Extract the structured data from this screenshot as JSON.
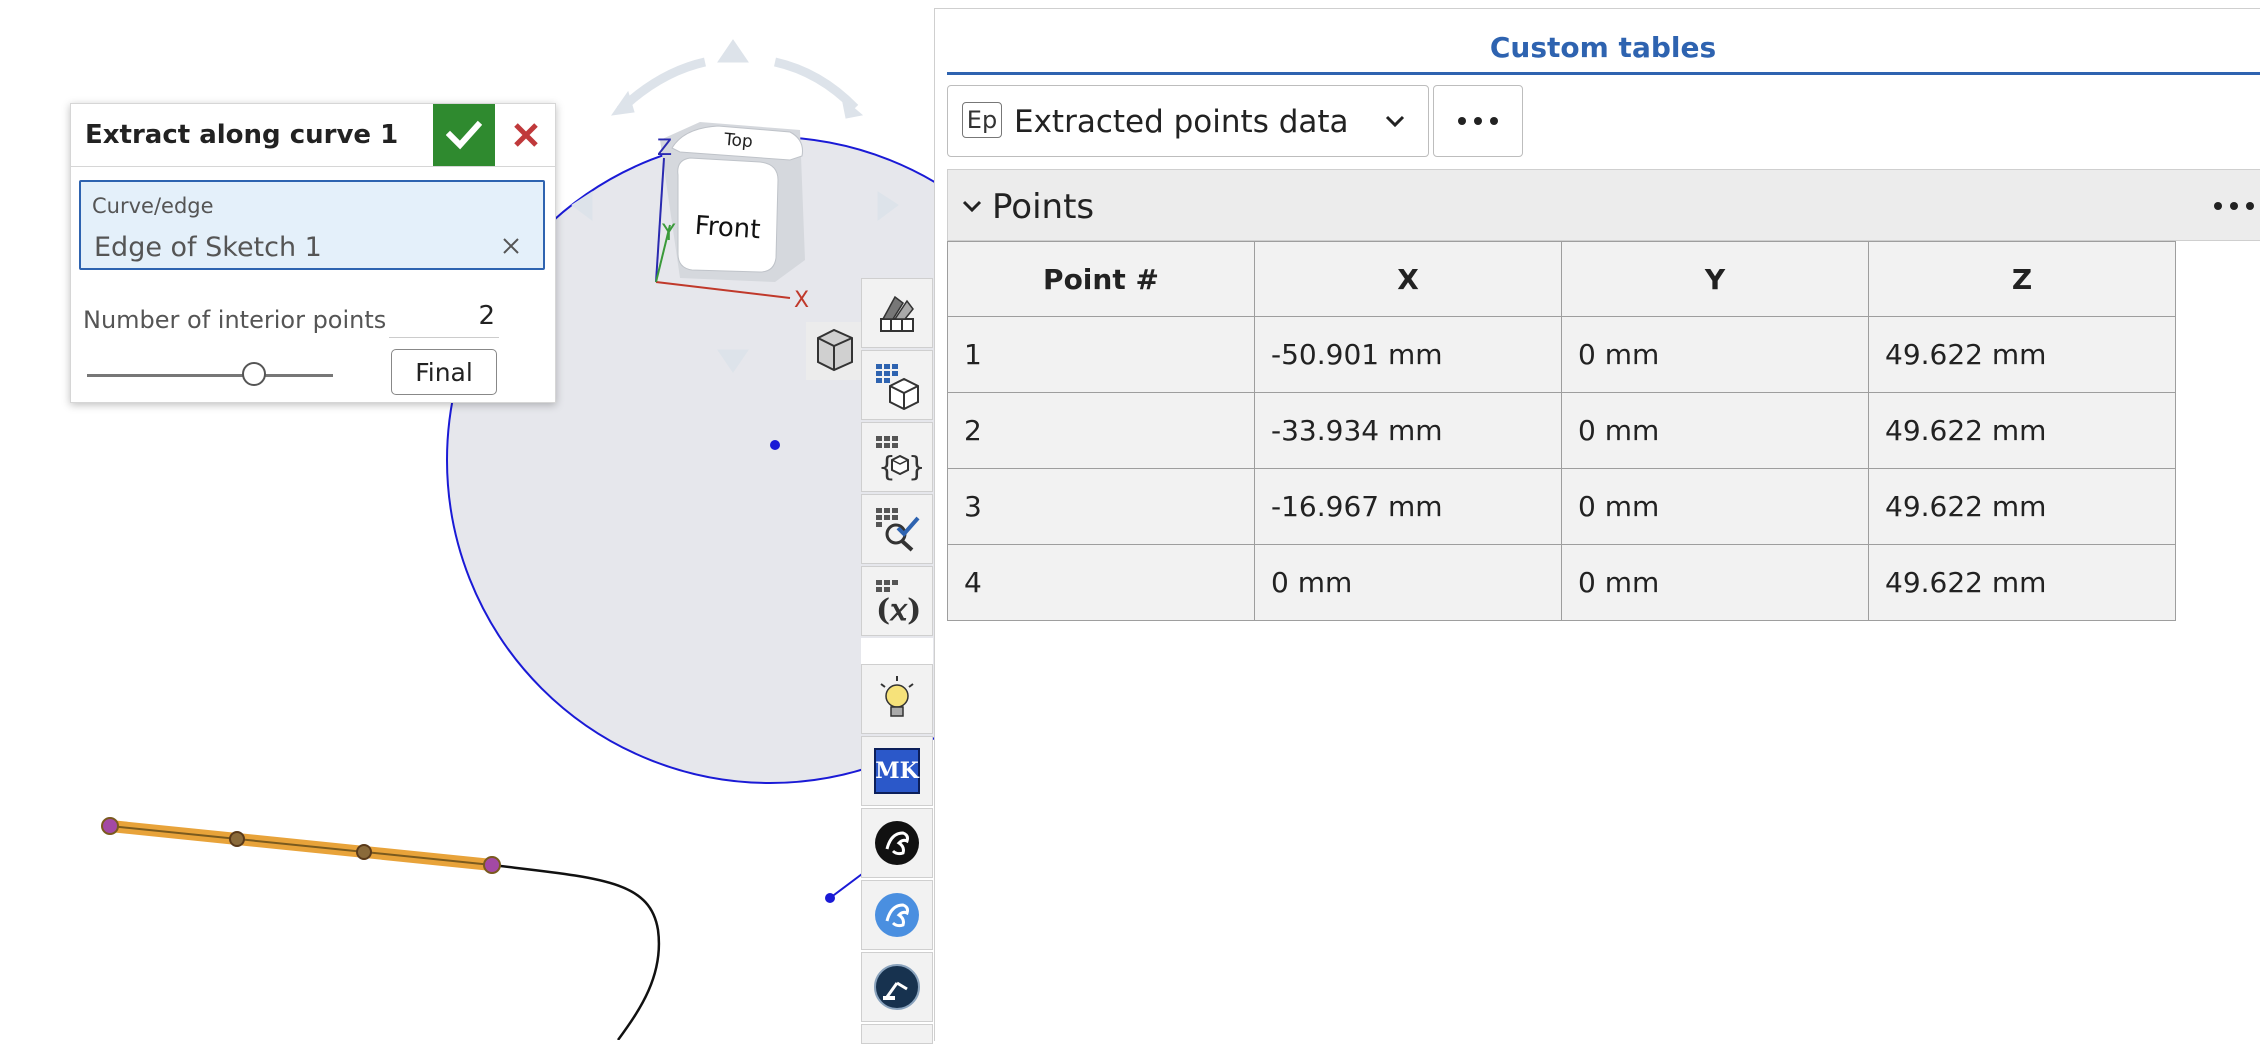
{
  "dialog": {
    "title": "Extract along curve 1",
    "curve_field_label": "Curve/edge",
    "curve_field_value": "Edge of Sketch 1",
    "interior_points_label": "Number of interior points",
    "interior_points_value": "2",
    "slider_value_fraction": 0.68,
    "final_button_label": "Final",
    "accept_color": "#2f8a2f",
    "cancel_color": "#c0393b"
  },
  "view_cube": {
    "face_front": "Front",
    "face_top": "Top",
    "axis_x": "X",
    "axis_y": "Y",
    "axis_z": "Z"
  },
  "toolbar": {
    "tools": [
      "appearance-tool-icon",
      "parts-table-icon",
      "variable-table-icon",
      "check-table-icon",
      "fx-table-icon",
      "lightbulb-icon",
      "mk-app-icon",
      "gecko-black-icon",
      "gecko-blue-icon",
      "robot-arm-icon"
    ],
    "mk_label": "MK"
  },
  "panel": {
    "title": "Custom tables",
    "table_badge": "Ep",
    "table_selected": "Extracted points data",
    "section_title": "Points",
    "columns": [
      "Point #",
      "X",
      "Y",
      "Z"
    ],
    "rows": [
      [
        "1",
        "-50.901 mm",
        "0 mm",
        "49.622 mm"
      ],
      [
        "2",
        "-33.934 mm",
        "0 mm",
        "49.622 mm"
      ],
      [
        "3",
        "-16.967 mm",
        "0 mm",
        "49.622 mm"
      ],
      [
        "4",
        "0 mm",
        "0 mm",
        "49.622 mm"
      ]
    ],
    "accent_color": "#2e63b0"
  }
}
